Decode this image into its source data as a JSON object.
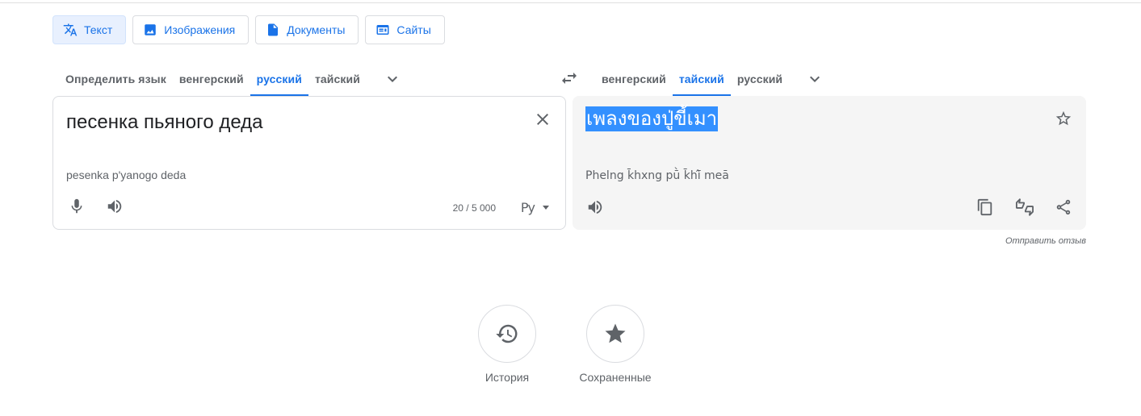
{
  "mode_tabs": [
    {
      "label": "Текст",
      "icon": "translate-icon",
      "active": true
    },
    {
      "label": "Изображения",
      "icon": "image-icon",
      "active": false
    },
    {
      "label": "Документы",
      "icon": "document-icon",
      "active": false
    },
    {
      "label": "Сайты",
      "icon": "website-icon",
      "active": false
    }
  ],
  "source_langs": {
    "items": [
      "Определить язык",
      "венгерский",
      "русский",
      "тайский"
    ],
    "active_index": 2
  },
  "target_langs": {
    "items": [
      "венгерский",
      "тайский",
      "русский"
    ],
    "active_index": 1
  },
  "source": {
    "text": "песенка пьяного деда",
    "transliteration": "pesenka p'yanogo deda",
    "char_count": "20 / 5 000",
    "input_method": "Ру"
  },
  "target": {
    "text": "เพลงของปู่ขี้เมา",
    "transliteration": "Phelng k̄hxng pū̀ k̄hī̂ meā"
  },
  "feedback": "Отправить отзыв",
  "bottom": {
    "history_label": "История",
    "saved_label": "Сохраненные"
  },
  "colors": {
    "accent": "#1a73e8",
    "active_tab_bg": "#e8f0fe",
    "target_panel_bg": "#f5f5f5",
    "selection": "#3390ff"
  }
}
